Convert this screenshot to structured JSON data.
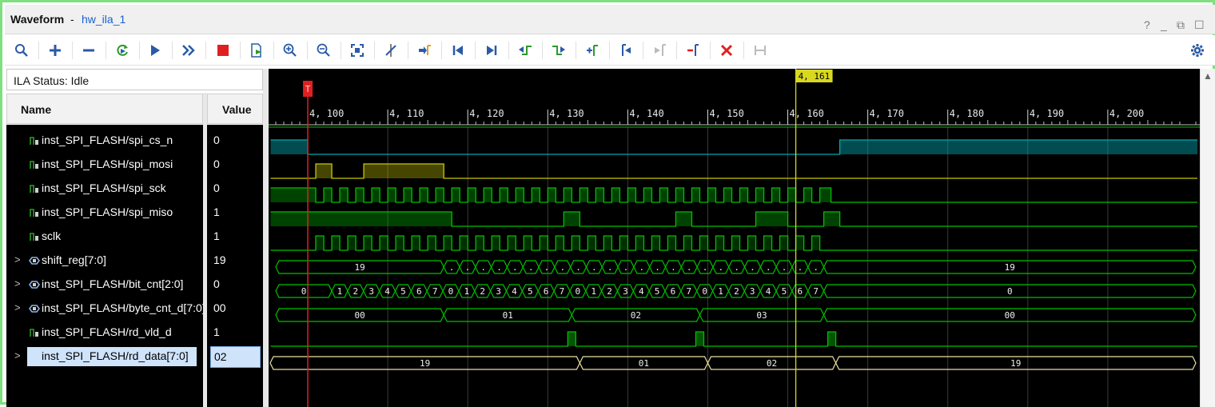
{
  "window": {
    "title": "Waveform",
    "separator": "-",
    "subtitle": "hw_ila_1",
    "controls": [
      "?",
      "_",
      "⧉",
      "☐"
    ]
  },
  "toolbar": {
    "buttons": [
      {
        "name": "search",
        "icon": "search-icon"
      },
      {
        "name": "add",
        "icon": "plus-icon"
      },
      {
        "name": "remove",
        "icon": "minus-icon"
      },
      {
        "name": "run-trigger-immediate",
        "icon": "refresh-run-icon"
      },
      {
        "name": "run-trigger",
        "icon": "play-icon"
      },
      {
        "name": "run-continuous",
        "icon": "fast-forward-icon"
      },
      {
        "name": "stop",
        "icon": "stop-icon"
      },
      {
        "name": "export",
        "icon": "export-icon"
      },
      {
        "name": "zoom-in",
        "icon": "zoom-in-icon"
      },
      {
        "name": "zoom-out",
        "icon": "zoom-out-icon"
      },
      {
        "name": "zoom-fit",
        "icon": "zoom-fit-icon"
      },
      {
        "name": "snap",
        "icon": "cursor-snap-icon"
      },
      {
        "name": "go-to-cursor",
        "icon": "go-cursor-icon"
      },
      {
        "name": "go-to-start",
        "icon": "go-start-icon"
      },
      {
        "name": "go-to-end",
        "icon": "go-end-icon"
      },
      {
        "name": "previous-transition",
        "icon": "prev-transition-icon"
      },
      {
        "name": "next-transition",
        "icon": "next-transition-icon"
      },
      {
        "name": "add-marker",
        "icon": "add-marker-icon"
      },
      {
        "name": "previous-marker",
        "icon": "prev-marker-icon"
      },
      {
        "name": "next-marker",
        "icon": "next-marker-icon"
      },
      {
        "name": "delete-marker",
        "icon": "delete-marker-icon"
      },
      {
        "name": "delete-all",
        "icon": "close-red-icon"
      },
      {
        "name": "swap-cursors",
        "icon": "swap-cursors-icon"
      },
      {
        "name": "settings",
        "icon": "gear-icon"
      }
    ]
  },
  "status": {
    "label": "ILA Status:",
    "value": "Idle"
  },
  "columns": {
    "name": "Name",
    "value": "Value"
  },
  "signals": [
    {
      "name": "inst_SPI_FLASH/spi_cs_n",
      "value": "0",
      "kind": "bit",
      "expandable": false
    },
    {
      "name": "inst_SPI_FLASH/spi_mosi",
      "value": "0",
      "kind": "bit",
      "expandable": false
    },
    {
      "name": "inst_SPI_FLASH/spi_sck",
      "value": "0",
      "kind": "bit",
      "expandable": false
    },
    {
      "name": "inst_SPI_FLASH/spi_miso",
      "value": "1",
      "kind": "bit",
      "expandable": false
    },
    {
      "name": "sclk",
      "value": "1",
      "kind": "bit",
      "expandable": false
    },
    {
      "name": "shift_reg[7:0]",
      "value": "19",
      "kind": "bus",
      "expandable": true
    },
    {
      "name": "inst_SPI_FLASH/bit_cnt[2:0]",
      "value": "0",
      "kind": "bus",
      "expandable": true
    },
    {
      "name": "inst_SPI_FLASH/byte_cnt_d[7:0]",
      "value": "00",
      "kind": "bus",
      "expandable": true
    },
    {
      "name": "inst_SPI_FLASH/rd_vld_d",
      "value": "1",
      "kind": "bit",
      "expandable": false
    },
    {
      "name": "inst_SPI_FLASH/rd_data[7:0]",
      "value": "02",
      "kind": "bus",
      "expandable": true,
      "selected": true
    }
  ],
  "timeline": {
    "start": 4095.1,
    "end": 4211.5,
    "major_ticks": [
      "4, 100",
      "4, 110",
      "4, 120",
      "4, 130",
      "4, 140",
      "4, 150",
      "4, 160",
      "4, 170",
      "4, 180",
      "4, 190",
      "4, 200"
    ],
    "major_tick_values": [
      4100,
      4110,
      4120,
      4130,
      4140,
      4150,
      4160,
      4170,
      4180,
      4190,
      4200
    ],
    "trigger_marker": {
      "label": "T",
      "sample": 4100
    },
    "cursor": {
      "label": "4, 161",
      "sample": 4161
    }
  },
  "colors": {
    "cs": "#00a8b4",
    "mosi": "#c8c800",
    "green": "#00c000",
    "rd": "#e8e0a0",
    "trigger": "#e02020",
    "cursor": "#d8d820",
    "grid": "#3a3a3a"
  },
  "waves": {
    "spi_cs_n": {
      "start": 1,
      "toggles": [
        4100,
        4166.5
      ]
    },
    "spi_mosi": {
      "start": 0,
      "toggles": [
        4101,
        4103,
        4107,
        4117
      ]
    },
    "spi_sck": {
      "start": 1,
      "clock": {
        "from": 4101,
        "period": 2,
        "count": 32,
        "first_low": true
      },
      "tail_high_from": 4165.4
    },
    "spi_miso": {
      "start": 1,
      "toggles": [
        4118,
        4132,
        4134,
        4146,
        4148,
        4156,
        4160,
        4164.5,
        4166.5
      ]
    },
    "sclk": {
      "start": 0,
      "clock": {
        "from": 4101,
        "period": 2,
        "count": 32,
        "first_low": false
      }
    },
    "shift_reg": {
      "segments": [
        {
          "from": 4096,
          "to": 4117,
          "label": "19"
        },
        {
          "from": 4164.5,
          "to": 4211,
          "label": "19"
        }
      ],
      "dense": {
        "from": 4117,
        "to": 4164.5,
        "count": 24,
        "label": "."
      }
    },
    "bit_cnt": {
      "initial": {
        "from": 4096,
        "to": 4103,
        "label": "0"
      },
      "sequence": [
        "1",
        "2",
        "3",
        "4",
        "5",
        "6",
        "7",
        "0",
        "1",
        "2",
        "3",
        "4",
        "5",
        "6",
        "7",
        "0",
        "1",
        "2",
        "3",
        "4",
        "5",
        "6",
        "7",
        "0",
        "1",
        "2",
        "3",
        "4",
        "5",
        "6",
        "7"
      ],
      "seq_from": 4103,
      "seq_to": 4164.5,
      "final": {
        "from": 4164.5,
        "to": 4211,
        "label": "0"
      }
    },
    "byte_cnt_d": {
      "segments": [
        {
          "from": 4096,
          "to": 4117,
          "label": "00"
        },
        {
          "from": 4117,
          "to": 4133,
          "label": "01"
        },
        {
          "from": 4133,
          "to": 4149,
          "label": "02"
        },
        {
          "from": 4149,
          "to": 4164.5,
          "label": "03"
        },
        {
          "from": 4164.5,
          "to": 4211,
          "label": "00"
        }
      ]
    },
    "rd_vld_d": {
      "start": 0,
      "toggles": [
        4132.5,
        4133.5,
        4148.5,
        4149.5,
        4165,
        4166
      ]
    },
    "rd_data": {
      "segments": [
        {
          "from": 4095.3,
          "to": 4134,
          "label": "19"
        },
        {
          "from": 4134,
          "to": 4150,
          "label": "01"
        },
        {
          "from": 4150,
          "to": 4166,
          "label": "02"
        },
        {
          "from": 4166,
          "to": 4211,
          "label": "19"
        }
      ]
    }
  }
}
